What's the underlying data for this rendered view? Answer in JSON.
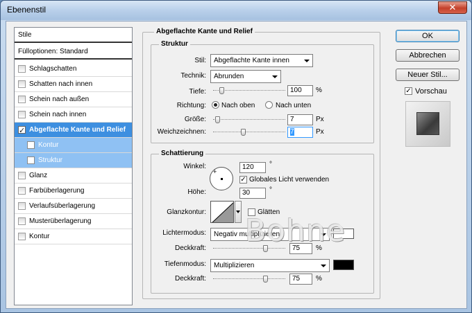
{
  "window": {
    "title": "Ebenenstil",
    "close_label": "✕"
  },
  "styles": {
    "header": "Stile",
    "blend_options": "Fülloptionen: Standard",
    "items": [
      {
        "label": "Schlagschatten",
        "checked": false
      },
      {
        "label": "Schatten nach innen",
        "checked": false
      },
      {
        "label": "Schein nach außen",
        "checked": false
      },
      {
        "label": "Schein nach innen",
        "checked": false
      },
      {
        "label": "Abgeflachte Kante und Relief",
        "checked": true,
        "active": true
      },
      {
        "label": "Kontur",
        "checked": false,
        "sub": true
      },
      {
        "label": "Struktur",
        "checked": false,
        "sub": true
      },
      {
        "label": "Glanz",
        "checked": false
      },
      {
        "label": "Farbüberlagerung",
        "checked": false
      },
      {
        "label": "Verlaufsüberlagerung",
        "checked": false
      },
      {
        "label": "Musterüberlagerung",
        "checked": false
      },
      {
        "label": "Kontur",
        "checked": false
      }
    ]
  },
  "bevel": {
    "title": "Abgeflachte Kante und Relief",
    "structure": {
      "title": "Struktur",
      "style_label": "Stil:",
      "style_value": "Abgeflachte Kante innen",
      "technique_label": "Technik:",
      "technique_value": "Abrunden",
      "depth_label": "Tiefe:",
      "depth_value": "100",
      "depth_unit": "%",
      "depth_level": 0.09,
      "direction_label": "Richtung:",
      "direction_up": "Nach oben",
      "direction_down": "Nach unten",
      "size_label": "Größe:",
      "size_value": "7",
      "size_unit": "Px",
      "size_level": 0.03,
      "soften_label": "Weichzeichnen:",
      "soften_value": "7",
      "soften_unit": "Px",
      "soften_level": 0.42
    },
    "shading": {
      "title": "Schattierung",
      "angle_label": "Winkel:",
      "angle_value": "120",
      "angle_unit": "°",
      "global_light_label": "Globales Licht verwenden",
      "altitude_label": "Höhe:",
      "altitude_value": "30",
      "altitude_unit": "°",
      "gloss_label": "Glanzkontur:",
      "antialias_label": "Glätten",
      "highlight_mode_label": "Lichtermodus:",
      "highlight_mode_value": "Negativ multiplizieren",
      "highlight_color": "#ffffff",
      "highlight_opacity_label": "Deckkraft:",
      "highlight_opacity_value": "75",
      "highlight_opacity_unit": "%",
      "highlight_opacity_level": 0.75,
      "shadow_mode_label": "Tiefenmodus:",
      "shadow_mode_value": "Multiplizieren",
      "shadow_color": "#000000",
      "shadow_opacity_label": "Deckkraft:",
      "shadow_opacity_value": "75",
      "shadow_opacity_unit": "%",
      "shadow_opacity_level": 0.75
    }
  },
  "buttons": {
    "ok": "OK",
    "cancel": "Abbrechen",
    "new_style": "Neuer Stil...",
    "preview_label": "Vorschau"
  },
  "watermark": "Bohne"
}
